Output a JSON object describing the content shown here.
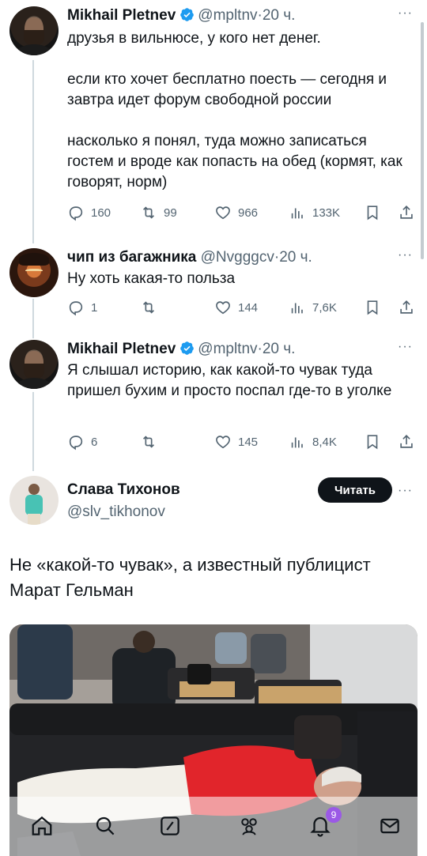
{
  "colors": {
    "text": "#0f1419",
    "muted": "#536471",
    "verified": "#1d9bf0",
    "thread_line": "#cfd9de",
    "badge": "#9b59e6"
  },
  "tweets": [
    {
      "name": "Mikhail Pletnev",
      "handle": "@mpltnv",
      "time": "20 ч.",
      "paragraphs": [
        "друзья в вильнюсе, у кого нет денег.",
        "если кто хочет бесплатно поесть — сегодня и завтра идет форум свободной россии",
        "насколько я понял, туда можно записаться гостем и вроде как попасть на обед (кормят, как говорят, норм)"
      ],
      "replies": "160",
      "retweets": "99",
      "likes": "966",
      "views": "133K"
    },
    {
      "name": "чип из багажника",
      "handle": "@Nvgggcv",
      "time": "20 ч.",
      "paragraphs": [
        "Ну хоть какая-то польза"
      ],
      "replies": "1",
      "retweets": "",
      "likes": "144",
      "views": "7,6K"
    },
    {
      "name": "Mikhail Pletnev",
      "handle": "@mpltnv",
      "time": "20 ч.",
      "paragraphs": [
        "Я слышал историю, как какой-то чувак туда пришел бухим и просто поспал где-то в уголке"
      ],
      "replies": "6",
      "retweets": "",
      "likes": "145",
      "views": "8,4K"
    }
  ],
  "main_tweet": {
    "name": "Слава Тихонов",
    "handle": "@slv_tikhonov",
    "follow_label": "Читать",
    "text": "Не «какой-то чувак», а известный публицист Марат Гельман"
  },
  "tabbar": {
    "icons": [
      "home-icon",
      "search-icon",
      "grok-icon",
      "communities-icon",
      "notifications-icon",
      "messages-icon"
    ],
    "notification_count": "9"
  }
}
